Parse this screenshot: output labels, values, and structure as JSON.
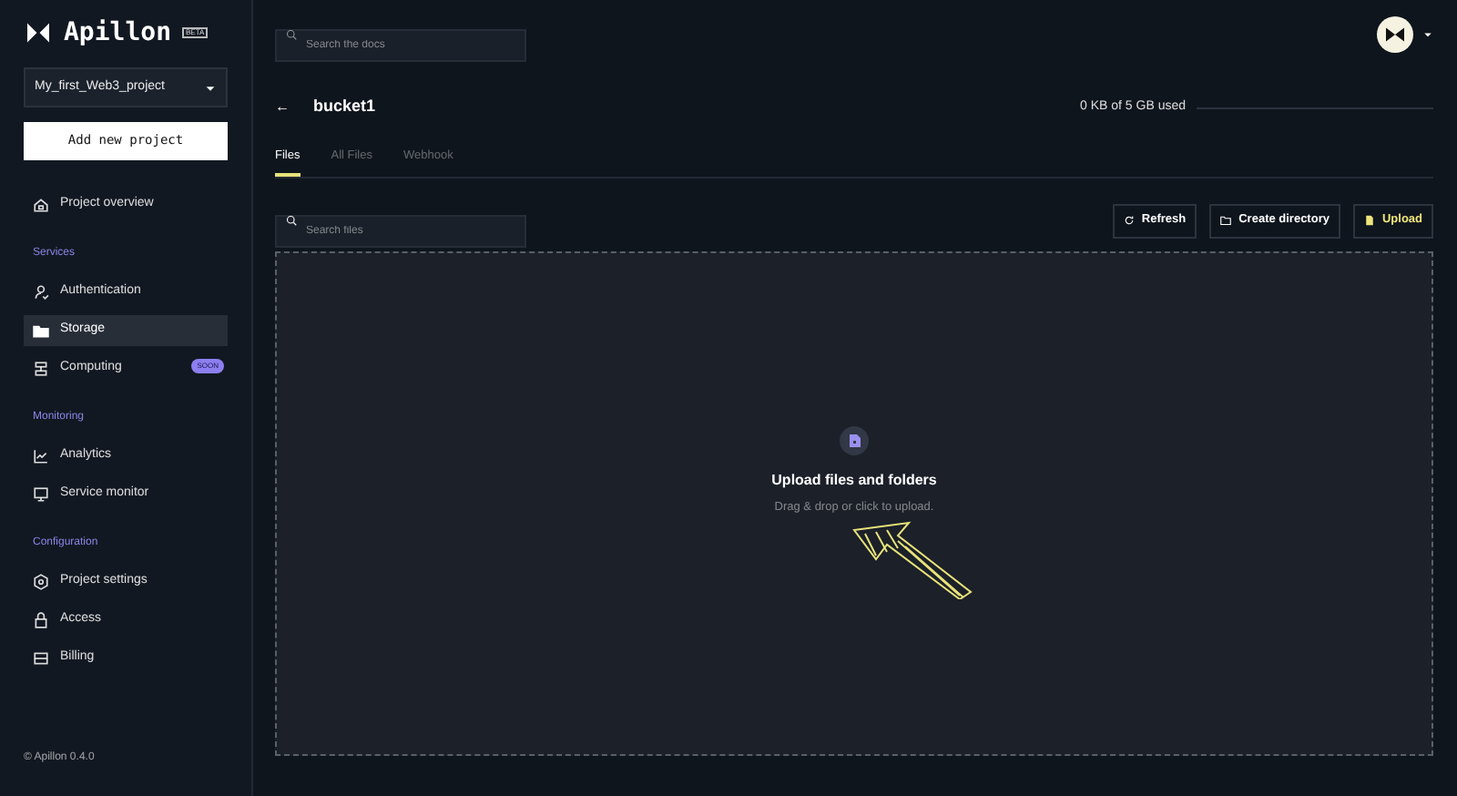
{
  "sidebar": {
    "logo": {
      "name": "Apillon",
      "badge": "BETA"
    },
    "project_select": {
      "value": "My_first_Web3_project"
    },
    "add_button": "Add new project",
    "top_items": [
      {
        "label": "Project overview",
        "kind": "home",
        "selected": false
      }
    ],
    "sections": [
      {
        "title": "Services",
        "items": [
          {
            "label": "Authentication",
            "kind": "user",
            "selected": false
          },
          {
            "label": "Storage",
            "kind": "folder",
            "selected": true
          },
          {
            "label": "Computing",
            "kind": "server",
            "selected": false,
            "badge": "SOON"
          }
        ]
      },
      {
        "title": "Monitoring",
        "items": [
          {
            "label": "Analytics",
            "kind": "chart",
            "selected": false
          },
          {
            "label": "Service monitor",
            "kind": "monitor",
            "selected": false
          }
        ]
      },
      {
        "title": "Configuration",
        "items": [
          {
            "label": "Project settings",
            "kind": "gear",
            "selected": false
          },
          {
            "label": "Access",
            "kind": "lock",
            "selected": false
          },
          {
            "label": "Billing",
            "kind": "card",
            "selected": false
          }
        ]
      }
    ],
    "footer": "© Apillon 0.4.0"
  },
  "header": {
    "search": {
      "placeholder": "Search the docs"
    }
  },
  "bucket": {
    "back": "←",
    "title": "bucket1",
    "usage": "0 KB of 5 GB used"
  },
  "tabs": [
    {
      "label": "Files",
      "selected": true
    },
    {
      "label": "All Files",
      "selected": false
    },
    {
      "label": "Webhook",
      "selected": false
    }
  ],
  "toolbar": {
    "search": {
      "placeholder": "Search files"
    },
    "buttons": [
      {
        "label": "Refresh",
        "kind": "refresh"
      },
      {
        "label": "Create directory",
        "kind": "folder"
      },
      {
        "label": "Upload",
        "kind": "upload"
      }
    ]
  },
  "dropzone": {
    "title": "Upload files and folders",
    "hint": "Drag & drop or click to upload."
  }
}
